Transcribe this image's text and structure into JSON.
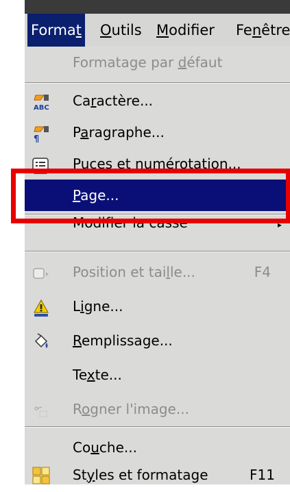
{
  "menubar": {
    "format": "Format",
    "outils": "Outils",
    "modifier": "Modifier",
    "fenetre": "Fenêtre"
  },
  "menu": {
    "formatage_defaut": "Formatage par défaut",
    "caractere": "Caractère...",
    "paragraphe": "Paragraphe...",
    "puces": "Puces et numérotation...",
    "page": "Page...",
    "casse": "Modifier la casse",
    "position": "Position et taille...",
    "position_shortcut": "F4",
    "ligne": "Ligne...",
    "remplissage": "Remplissage...",
    "texte": "Texte...",
    "rogner": "Rogner l'image...",
    "couche": "Couche...",
    "styles": "Styles et formatage",
    "styles_shortcut": "F11"
  },
  "icons": {
    "caractere": "character-abc-icon",
    "paragraphe": "paragraph-icon",
    "puces": "bullets-list-icon",
    "position": "position-size-icon",
    "ligne": "line-icon",
    "remplissage": "fill-bucket-icon",
    "rogner": "crop-icon",
    "styles": "styles-formatting-icon"
  },
  "colors": {
    "selection": "#0a0f78",
    "highlight_border": "#e60000",
    "menu_bg": "#dadad8"
  }
}
